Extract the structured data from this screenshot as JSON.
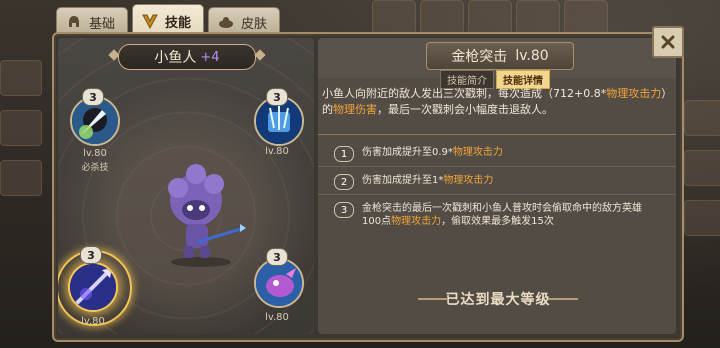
{
  "tabs": [
    {
      "label": "基础",
      "icon": "helmet-icon"
    },
    {
      "label": "技能",
      "icon": "skill-crest-icon",
      "active": true
    },
    {
      "label": "皮肤",
      "icon": "skin-icon"
    }
  ],
  "hero": {
    "name": "小鱼人",
    "plus": "+4"
  },
  "skills": [
    {
      "badge": "3",
      "level": "lv.80",
      "tag": "必杀技"
    },
    {
      "badge": "3",
      "level": "lv.80"
    },
    {
      "badge": "3",
      "level": "lv.80"
    },
    {
      "badge": "3",
      "level": "lv.80"
    }
  ],
  "detail": {
    "title": "金枪突击",
    "level": "lv.80",
    "subtabs": [
      "技能简介",
      "技能详情"
    ],
    "desc_a": "小鱼人向附近的敌人发出三次戳刺，每次造成（712+0.8*",
    "desc_hl1": "物理攻击力",
    "desc_b": "）的",
    "desc_hl2": "物理伤害",
    "desc_c": "，最后一次戳刺会小幅度击退敌人。",
    "upgrades": [
      {
        "num": "1",
        "text": "伤害加成提升至0.9*",
        "hl": "物理攻击力",
        "tail": ""
      },
      {
        "num": "2",
        "text": "伤害加成提升至1*",
        "hl": "物理攻击力",
        "tail": ""
      },
      {
        "num": "3",
        "text": "金枪突击的最后一次戳刺和小鱼人普攻时会偷取命中的敌方英雄100点",
        "hl": "物理攻击力",
        "tail": "，偷取效果最多触发15次"
      }
    ],
    "maxed_label": "已达到最大等级"
  }
}
